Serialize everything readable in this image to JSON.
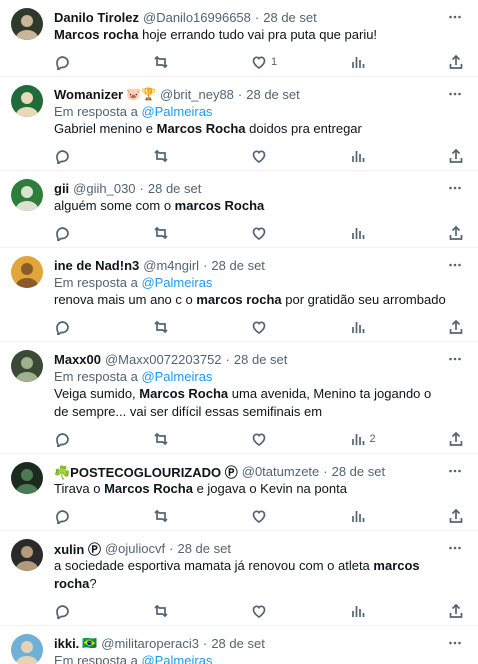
{
  "tweets": [
    {
      "name": "Danilo Tirolez",
      "emoji": "",
      "handle": "@Danilo16996658",
      "time": "28 de set",
      "reply_prefix": "",
      "reply_to": "",
      "segments": [
        {
          "t": "Marcos rocha",
          "b": true
        },
        {
          "t": " hoje errando tudo vai pra puta que pariu!",
          "b": false
        }
      ],
      "likes": "1",
      "views": "",
      "avatar_colors": [
        "#2f3a2c",
        "#c8b59a"
      ]
    },
    {
      "name": "Womanizer",
      "emoji": "🐷🏆",
      "handle": "@brit_ney88",
      "time": "28 de set",
      "reply_prefix": "Em resposta a ",
      "reply_to": "@Palmeiras",
      "segments": [
        {
          "t": "Gabriel menino e ",
          "b": false
        },
        {
          "t": "Marcos Rocha",
          "b": true
        },
        {
          "t": " doidos pra entregar",
          "b": false
        }
      ],
      "likes": "",
      "views": "",
      "avatar_colors": [
        "#1f6b3a",
        "#e8d9b8"
      ]
    },
    {
      "name": "gii",
      "emoji": "",
      "handle": "@giih_030",
      "time": "28 de set",
      "reply_prefix": "",
      "reply_to": "",
      "segments": [
        {
          "t": "alguém some com o ",
          "b": false
        },
        {
          "t": "marcos Rocha",
          "b": true
        }
      ],
      "likes": "",
      "views": "",
      "avatar_colors": [
        "#2e7d3b",
        "#d9e3d0"
      ]
    },
    {
      "name": "ine de Nad!n3",
      "emoji": "",
      "handle": "@m4ngirl",
      "time": "28 de set",
      "reply_prefix": "Em resposta a ",
      "reply_to": "@Palmeiras",
      "segments": [
        {
          "t": "renova mais um ano c o ",
          "b": false
        },
        {
          "t": "marcos rocha",
          "b": true
        },
        {
          "t": " por gratidão seu arrombado",
          "b": false
        }
      ],
      "likes": "",
      "views": "",
      "avatar_colors": [
        "#e0a63a",
        "#8a5a2b"
      ]
    },
    {
      "name": "Maxx00",
      "emoji": "",
      "handle": "@Maxx0072203752",
      "time": "28 de set",
      "reply_prefix": "Em resposta a ",
      "reply_to": "@Palmeiras",
      "segments": [
        {
          "t": "Veiga sumido, ",
          "b": false
        },
        {
          "t": "Marcos Rocha",
          "b": true
        },
        {
          "t": " uma avenida, Menino ta jogando o de sempre... vai ser difícil essas semifinais em",
          "b": false
        }
      ],
      "likes": "",
      "views": "2",
      "avatar_colors": [
        "#3b4a36",
        "#9fb08c"
      ]
    },
    {
      "name": "☘️POSTECOGLOURIZADO Ⓟ",
      "emoji": "",
      "handle": "@0tatumzete",
      "time": "28 de set",
      "reply_prefix": "",
      "reply_to": "",
      "segments": [
        {
          "t": "Tirava o ",
          "b": false
        },
        {
          "t": "Marcos Rocha",
          "b": true
        },
        {
          "t": " e jogava o Kevin na ponta",
          "b": false
        }
      ],
      "likes": "",
      "views": "",
      "avatar_colors": [
        "#1c2a1f",
        "#4d7a55"
      ]
    },
    {
      "name": "xulin Ⓟ",
      "emoji": "",
      "handle": "@ojuliocvf",
      "time": "28 de set",
      "reply_prefix": "",
      "reply_to": "",
      "segments": [
        {
          "t": "a sociedade esportiva mamata já renovou com o atleta ",
          "b": false
        },
        {
          "t": "marcos rocha",
          "b": true
        },
        {
          "t": "?",
          "b": false
        }
      ],
      "likes": "",
      "views": "",
      "avatar_colors": [
        "#2a2a2a",
        "#b39a7a"
      ]
    },
    {
      "name": "ikki.",
      "emoji": "🇧🇷",
      "handle": "@militaroperaci3",
      "time": "28 de set",
      "reply_prefix": "Em resposta a ",
      "reply_to": "@Palmeiras",
      "segments": [],
      "likes": "",
      "views": "",
      "avatar_colors": [
        "#6fb0d6",
        "#e6d3b5"
      ]
    }
  ]
}
